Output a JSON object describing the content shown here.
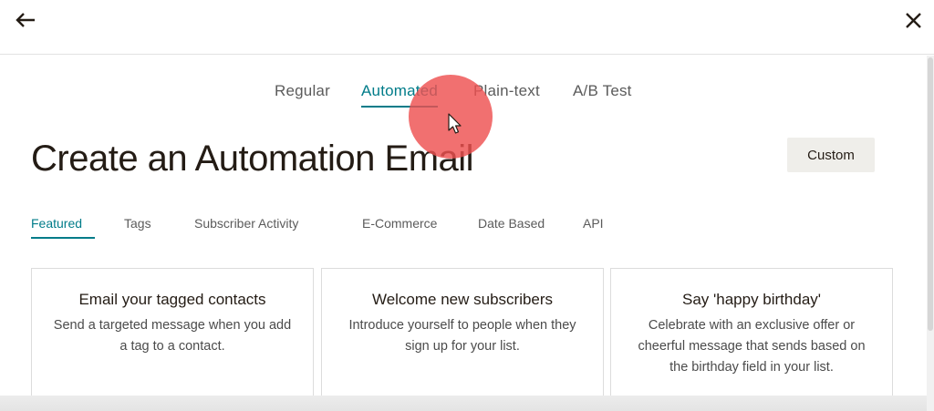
{
  "colors": {
    "accent": "#007c89",
    "text": "#241c15",
    "button_bg": "#efeeea",
    "cursor_highlight": "#ee5050"
  },
  "topbar": {
    "back_icon": "arrow-left-icon",
    "close_icon": "close-icon"
  },
  "type_tabs": [
    {
      "label": "Regular",
      "active": false
    },
    {
      "label": "Automated",
      "active": true
    },
    {
      "label": "Plain-text",
      "active": false
    },
    {
      "label": "A/B Test",
      "active": false
    }
  ],
  "title": "Create an Automation Email",
  "custom_button": "Custom",
  "category_tabs": [
    {
      "label": "Featured",
      "active": true
    },
    {
      "label": "Tags",
      "active": false
    },
    {
      "label": "Subscriber Activity",
      "active": false
    },
    {
      "label": "E-Commerce",
      "active": false
    },
    {
      "label": "Date Based",
      "active": false
    },
    {
      "label": "API",
      "active": false
    }
  ],
  "cards": [
    {
      "title": "Email your tagged contacts",
      "description": "Send a targeted message when you add a tag to a contact."
    },
    {
      "title": "Welcome new subscribers",
      "description": "Introduce yourself to people when they sign up for your list."
    },
    {
      "title": "Say 'happy birthday'",
      "description": "Celebrate with an exclusive offer or cheerful message that sends based on the birthday field in your list."
    }
  ]
}
